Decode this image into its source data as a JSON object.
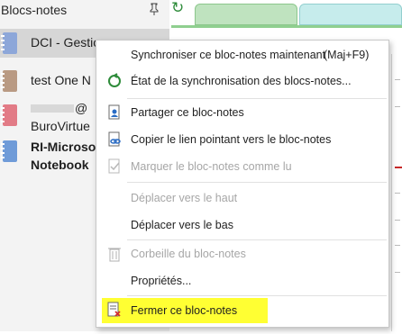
{
  "panel": {
    "title": "Blocs-notes",
    "notebooks": [
      {
        "label": "DCI - Gestio",
        "color": "#8da7d9",
        "selected": true
      },
      {
        "label": "test One N",
        "color": "#b99a83",
        "selected": false
      },
      {
        "label": "@",
        "color": "#e27b86",
        "selected": false
      },
      {
        "label": "BuroVirtue",
        "color": "",
        "selected": false
      },
      {
        "label": "RI-Microso",
        "color": "#6f9bd8",
        "selected": false
      },
      {
        "label": "Notebook",
        "color": "",
        "selected": false
      }
    ]
  },
  "context_menu": {
    "items": [
      {
        "label": "Synchroniser ce bloc-notes maintenant",
        "shortcut": "(Maj+F9)",
        "icon": "none",
        "enabled": true
      },
      {
        "label": "État de la synchronisation des blocs-notes...",
        "icon": "sync-icon",
        "enabled": true
      },
      {
        "label": "Partager ce bloc-notes",
        "icon": "share-icon",
        "enabled": true
      },
      {
        "label": "Copier le lien pointant vers le bloc-notes",
        "icon": "copy-link-icon",
        "enabled": true
      },
      {
        "label": "Marquer le bloc-notes comme lu",
        "icon": "mark-read-icon",
        "enabled": false
      },
      {
        "label": "Déplacer vers le haut",
        "icon": "none",
        "enabled": false
      },
      {
        "label": "Déplacer vers le bas",
        "icon": "none",
        "enabled": true
      },
      {
        "label": "Corbeille du bloc-notes",
        "icon": "recycle-bin-icon",
        "enabled": false
      },
      {
        "label": "Propriétés...",
        "icon": "none",
        "enabled": true
      },
      {
        "label": "Fermer ce bloc-notes",
        "icon": "close-notebook-icon",
        "enabled": true,
        "highlighted": true,
        "highlight_color": "#ffff33"
      }
    ]
  },
  "colors": {
    "accent_green": "#2e8b3a",
    "tab_green": "#bfe3bf",
    "tab_teal": "#c6ecec"
  }
}
